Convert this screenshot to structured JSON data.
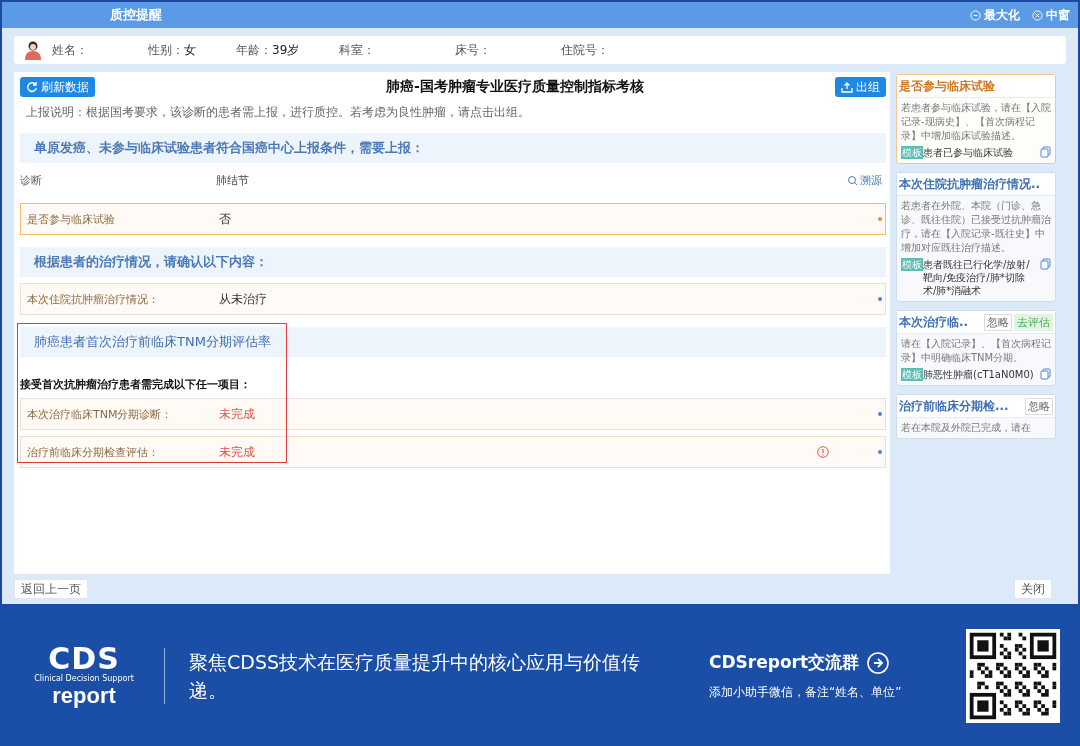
{
  "window": {
    "title": "质控提醒",
    "controls": [
      {
        "kind": "maximize",
        "label": "最大化"
      },
      {
        "kind": "close",
        "label": "中窗"
      }
    ]
  },
  "patient": {
    "fields": [
      {
        "label": "姓名："
      },
      {
        "label": "性别：",
        "value": "女"
      },
      {
        "label": "年龄：",
        "value": "39岁"
      },
      {
        "label": "科室："
      },
      {
        "label": "床号："
      },
      {
        "label": "住院号："
      }
    ]
  },
  "main": {
    "refresh_button": "刷新数据",
    "title": "肺癌-国考肿瘤专业医疗质量控制指标考核",
    "exit_button": "出组",
    "note": "上报说明：根据国考要求，该诊断的患者需上报，进行质控。若考虑为良性肿瘤，请点击出组。",
    "sections": [
      {
        "heading": "单原发癌、未参与临床试验患者符合国癌中心上报条件，需要上报：",
        "highlighted": false,
        "items": [
          {
            "kind": "plain",
            "label": "诊断",
            "value": "肺结节",
            "action": "溯源"
          },
          {
            "kind": "field",
            "label": "是否参与临床试验",
            "value": "否",
            "active": true,
            "incomplete": false,
            "warning": false
          }
        ]
      },
      {
        "heading": "根据患者的治疗情况，请确认以下内容：",
        "highlighted": false,
        "items": [
          {
            "kind": "field",
            "label": "本次住院抗肿瘤治疗情况：",
            "value": "从未治疗",
            "active": false,
            "incomplete": false,
            "warning": false
          }
        ]
      },
      {
        "heading": "肺癌患者首次治疗前临床TNM分期评估率",
        "highlighted": true,
        "items": [
          {
            "kind": "subheading",
            "label": "接受首次抗肿瘤治疗患者需完成以下任一项目："
          },
          {
            "kind": "field",
            "label": "本次治疗临床TNM分期诊断：",
            "value": "未完成",
            "active": false,
            "incomplete": true,
            "warning": false
          },
          {
            "kind": "field",
            "label": "治疗前临床分期检查评估：",
            "value": "未完成",
            "active": false,
            "incomplete": true,
            "warning": true
          }
        ]
      }
    ]
  },
  "sidebar": {
    "cards": [
      {
        "title": "是否参与临床试验",
        "active": true,
        "description": "若患者参与临床试验，请在【入院记录-现病史】、【首次病程记录】中增加临床试验描述。",
        "template": {
          "tag": "模板",
          "text": "患者已参与临床试验"
        }
      },
      {
        "title": "本次住院抗肿瘤治疗情况..",
        "active": false,
        "description": "若患者在外院、本院（门诊、急诊、既往住院）已接受过抗肿瘤治疗，请在【入院记录-既往史】中增加对应既往治疗描述。",
        "template": {
          "tag": "模板",
          "text": "患者既往已行化学/放射/靶向/免疫治疗/肺*切除术/肺*消融术"
        }
      },
      {
        "title": "本次治疗临..",
        "active": false,
        "buttons": [
          {
            "kind": "ignore",
            "label": "忽略"
          },
          {
            "kind": "evaluate",
            "label": "去评估"
          }
        ],
        "description": "请在【入院记录】、【首次病程记录】中明确临床TNM分期。",
        "template": {
          "tag": "模板",
          "text": "肺恶性肿瘤(cT1aN0M0)"
        }
      },
      {
        "title": "治疗前临床分期检...",
        "active": false,
        "buttons": [
          {
            "kind": "ignore",
            "label": "忽略"
          }
        ],
        "description": "若在本院及外院已完成，请在"
      }
    ]
  },
  "footer": {
    "back_button": "返回上一页",
    "close_button": "关闭"
  },
  "banner": {
    "logo": {
      "top": "CDS",
      "middle": "Clinical Decision Support",
      "bottom": "report"
    },
    "tagline": "聚焦CDSS技术在医疗质量提升中的核心应用与价值传递。",
    "group": "CDSreport交流群",
    "group_note": "添加小助手微信，备注“姓名、单位”"
  }
}
